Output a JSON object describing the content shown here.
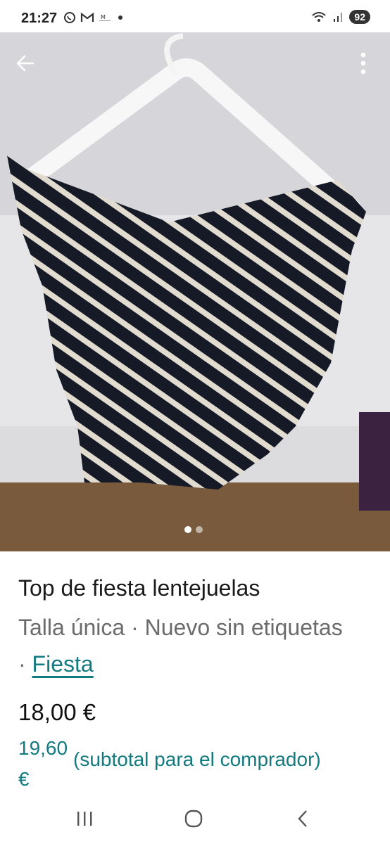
{
  "status_bar": {
    "time": "21:27",
    "notification_icons": [
      "whatsapp-icon",
      "gmail-icon",
      "app-icon",
      "dot-icon"
    ],
    "battery": "92"
  },
  "product": {
    "image_count": 2,
    "active_image": 1,
    "title": "Top de fiesta lentejuelas",
    "size_condition": "Talla única · Nuevo sin etiquetas · ",
    "category_link": "Fiesta",
    "price": "18,00 €",
    "buyer_price": "19,60 €",
    "buyer_note": "(subtotal para el comprador)"
  },
  "colors": {
    "accent": "#137a7f"
  }
}
